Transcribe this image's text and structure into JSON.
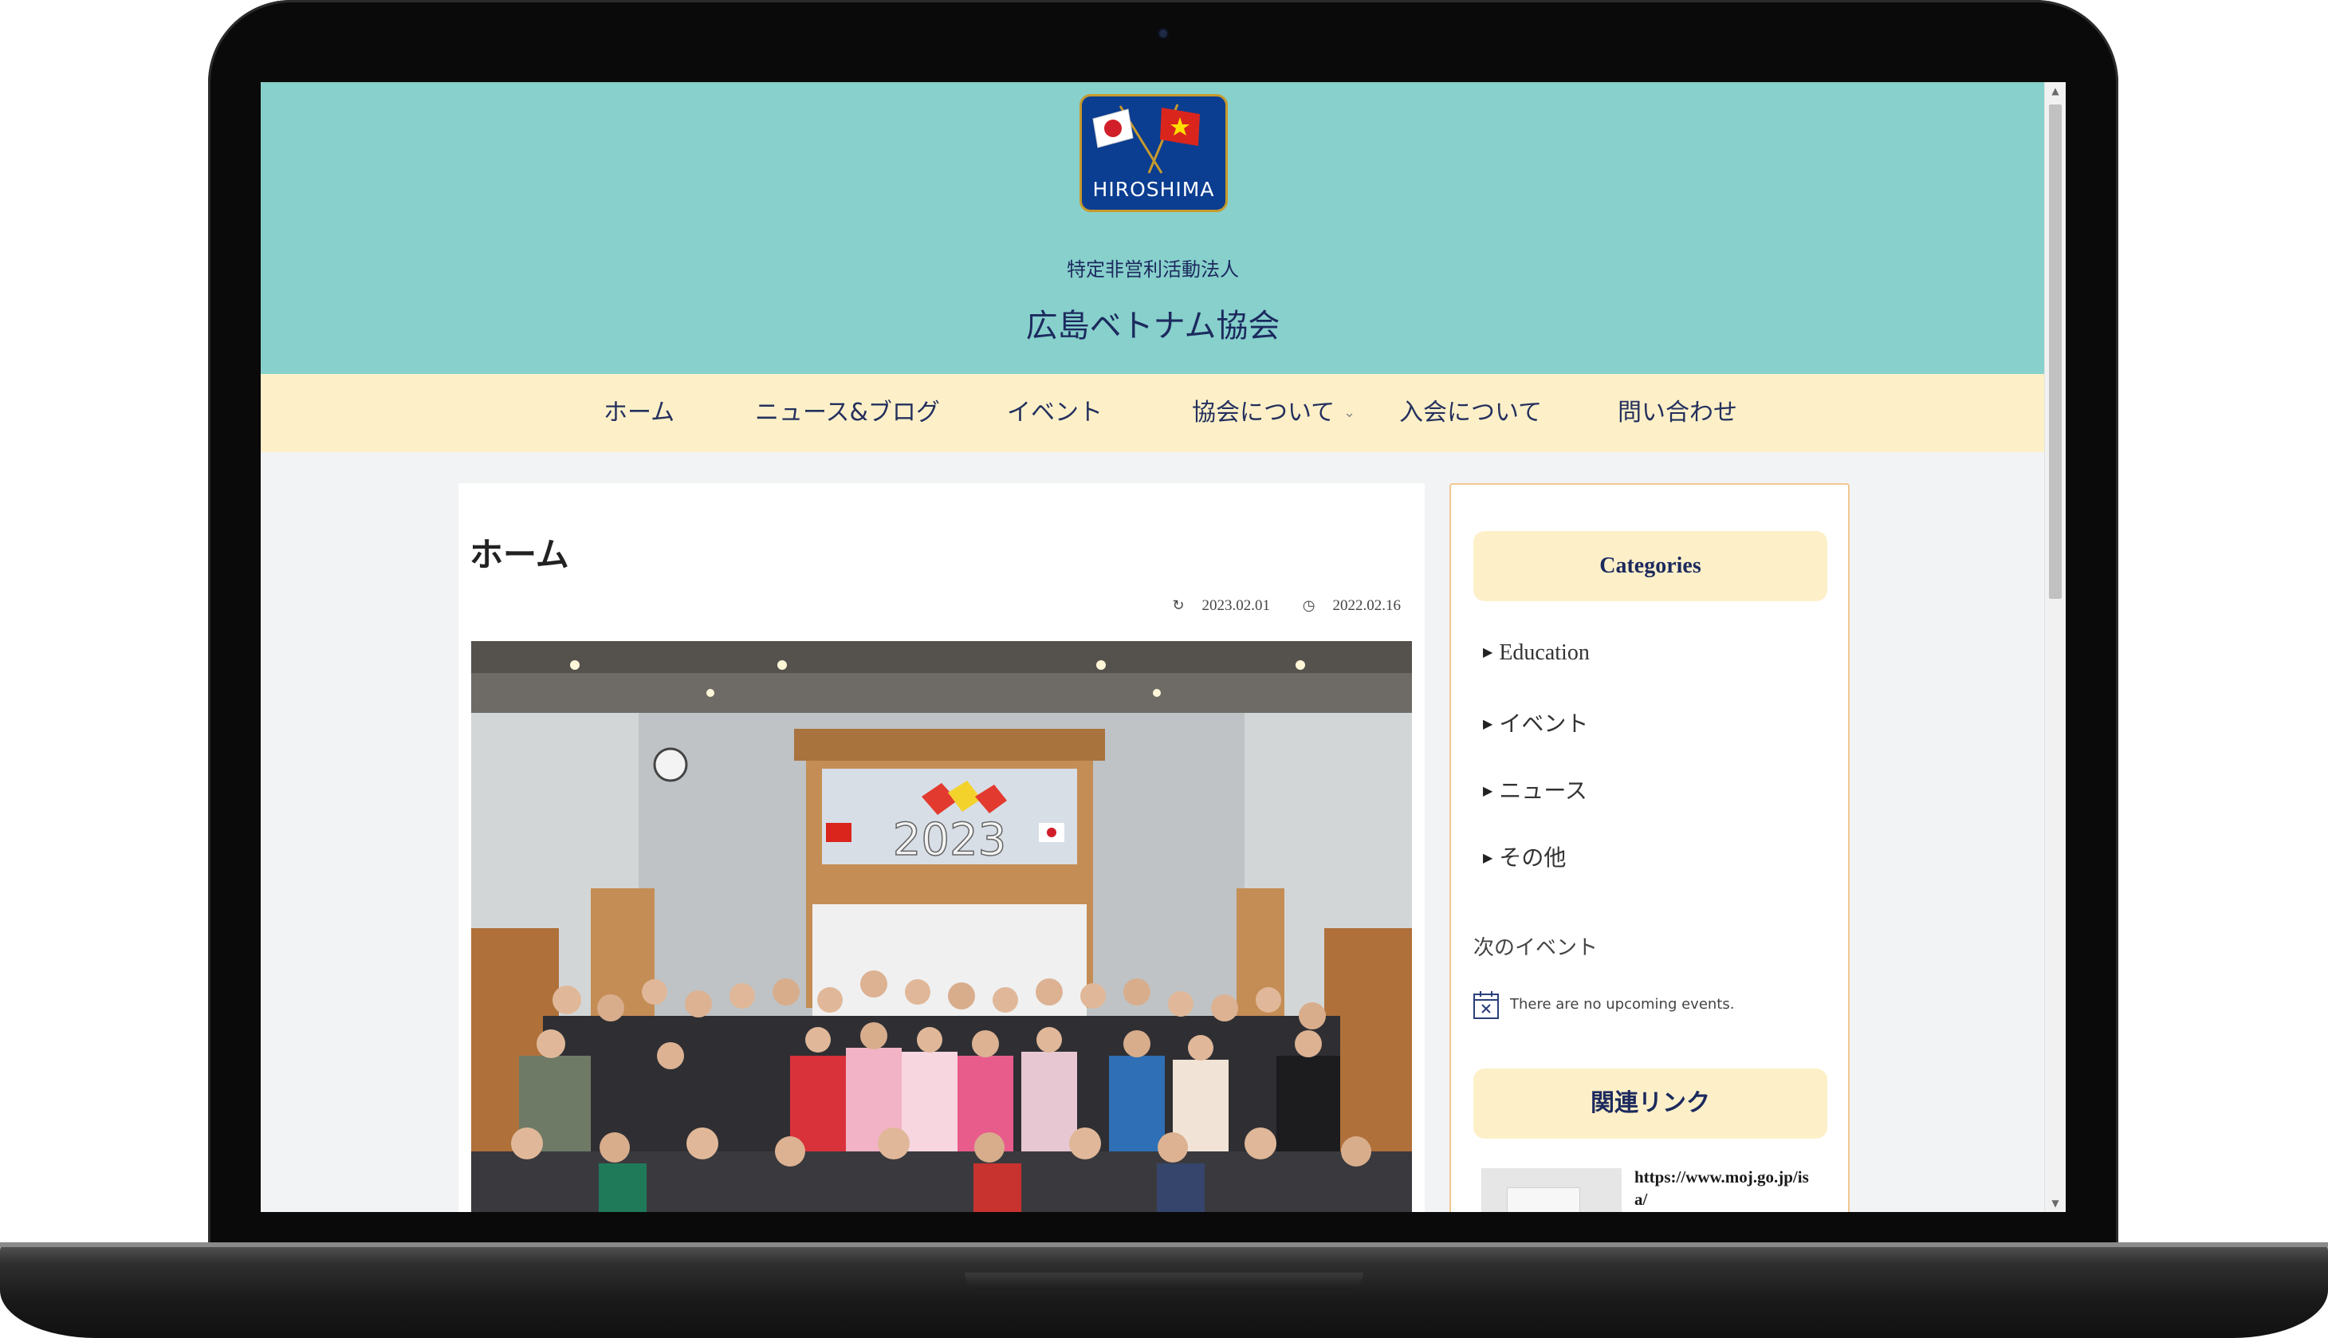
{
  "header": {
    "logo_text": "HIROSHIMA",
    "org_type": "特定非営利活動法人",
    "site_title": "広島ベトナム協会"
  },
  "nav": {
    "items": [
      {
        "label": "ホーム"
      },
      {
        "label": "ニュース&ブログ"
      },
      {
        "label": "イベント"
      },
      {
        "label": "協会について",
        "has_submenu": true
      },
      {
        "label": "入会について"
      },
      {
        "label": "問い合わせ"
      }
    ],
    "chevron_icon": "chevron-down-icon"
  },
  "main": {
    "page_title": "ホーム",
    "updated_date": "2023.02.01",
    "published_date": "2022.02.16",
    "updated_icon": "refresh-icon",
    "published_icon": "clock-icon",
    "photo_banner_text": "2023"
  },
  "sidebar": {
    "categories_title": "Categories",
    "categories": [
      {
        "label": "Education"
      },
      {
        "label": "イベント"
      },
      {
        "label": "ニュース"
      },
      {
        "label": "その他"
      }
    ],
    "events_title": "次のイベント",
    "events_empty": "There are no upcoming events.",
    "links_title": "関連リンク",
    "link_url": "https://www.moj.go.jp/isa/"
  },
  "colors": {
    "header_bg": "#87d0cc",
    "nav_bg": "#fdf0c8",
    "text_navy": "#1c2a5e",
    "sidebar_border": "#f0c890"
  }
}
